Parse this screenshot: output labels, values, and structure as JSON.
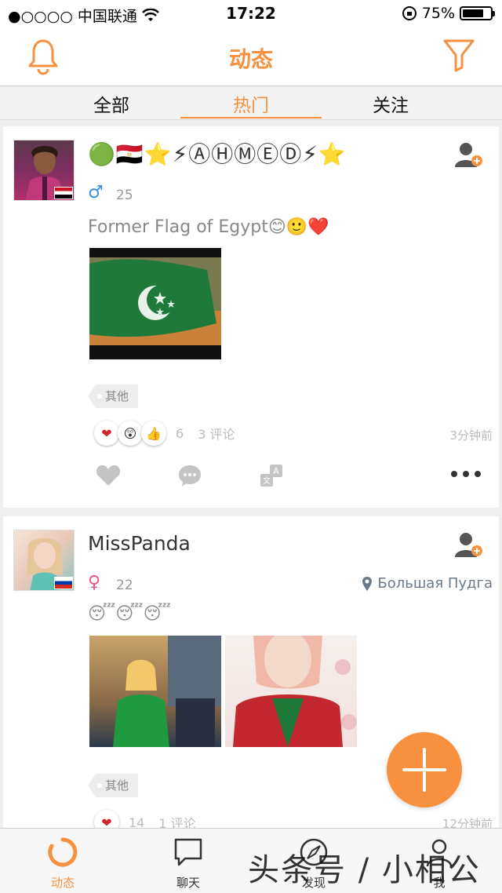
{
  "status_bar": {
    "carrier": "●○○○○ 中国联通",
    "time": "17:22",
    "battery": "75%",
    "battery_level": 0.75
  },
  "nav": {
    "title": "动态"
  },
  "tabs": [
    {
      "label": "全部"
    },
    {
      "label": "热门"
    },
    {
      "label": "关注"
    }
  ],
  "posts": [
    {
      "username_decor": "🟢🇪🇬⭐⚡ⒶⒽⓂⒺⒹ⚡⭐",
      "gender_symbol": "♂",
      "age": "25",
      "text": "Former Flag of Egypt😊🙂❤️",
      "tag": "其他",
      "reaction_count": "6",
      "comments": "3 评论",
      "time": "3分钟前"
    },
    {
      "username": "MissPanda",
      "gender_symbol": "♀",
      "age": "22",
      "location": "Большая Пудга",
      "text": "😴😴😴",
      "tag": "其他",
      "reaction_count": "14",
      "comments": "1 评论",
      "time": "12分钟前"
    }
  ],
  "bottom_tabs": [
    {
      "label": "动态"
    },
    {
      "label": "聊天"
    },
    {
      "label": "发现"
    },
    {
      "label": "我"
    }
  ],
  "watermark": "头条号 / 小相公",
  "colors": {
    "accent": "#f7913f",
    "muted": "#bbbbbb"
  }
}
